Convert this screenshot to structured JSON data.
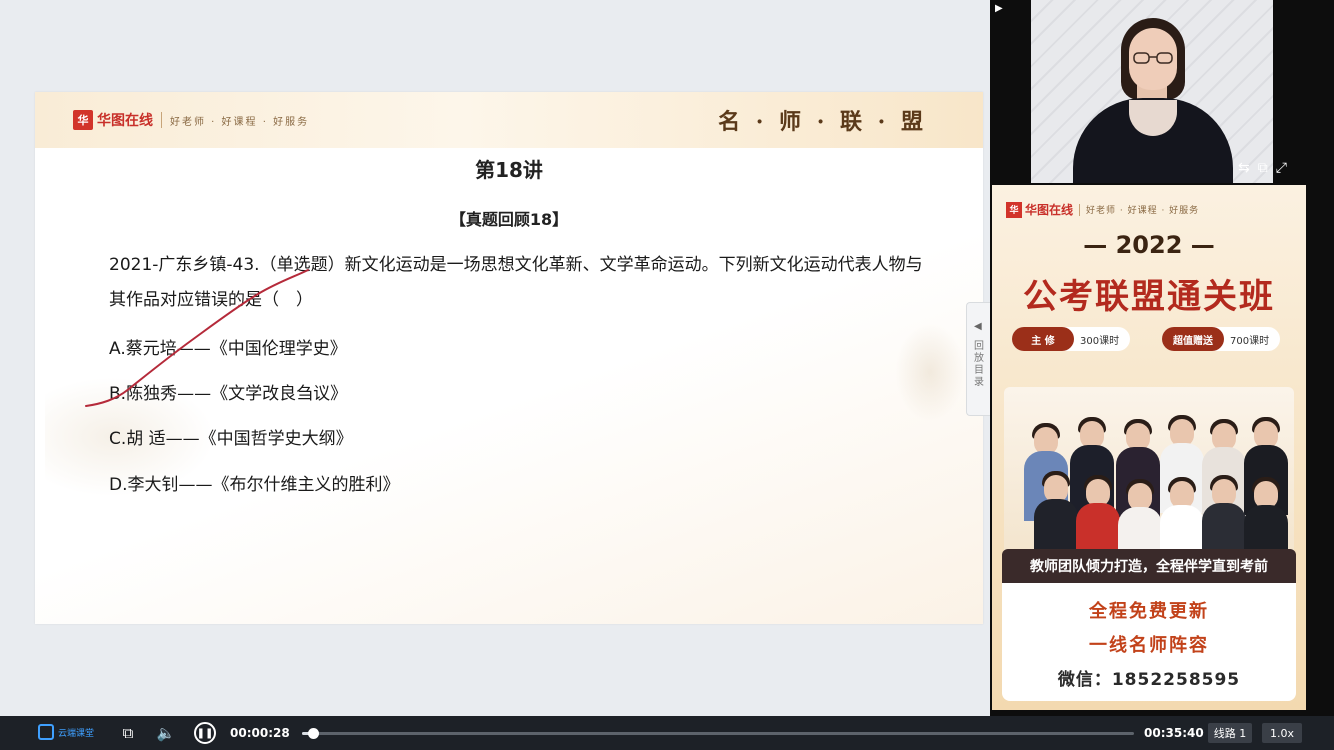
{
  "slide": {
    "brand_logo": "华",
    "brand_name": "华图在线",
    "brand_slogan": "好老师 · 好课程 · 好服务",
    "header_right": "名 · 师 · 联 · 盟",
    "lecture_title": "第18讲",
    "review_title": "【真题回顾18】",
    "question": "2021-广东乡镇-43.（单选题）新文化运动是一场思想文化革新、文学革命运动。下列新文化运动代表人物与其作品对应错误的是（　）",
    "options": [
      "A.蔡元培——《中国伦理学史》",
      "B.陈独秀——《文学改良刍议》",
      "C.胡 适——《中国哲学史大纲》",
      "D.李大钊——《布尔什维主义的胜利》"
    ],
    "pen_color": "#b52a3a"
  },
  "sidebar": {
    "collapse_arrow": "◀",
    "collapse_label": "回放目录"
  },
  "camera": {
    "top_arrow": "▶",
    "controls": [
      "⇆",
      "⧉",
      "⤢"
    ]
  },
  "ad": {
    "brand_logo": "华",
    "brand_name": "华图在线",
    "brand_slogan": "好老师 · 好课程 · 好服务",
    "year": "— 2022 —",
    "title": "公考联盟通关班",
    "pills": [
      {
        "tag": "主 修",
        "value": "300课时"
      },
      {
        "tag": "超值赠送",
        "value": "700课时"
      }
    ],
    "caption": "教师团队倾力打造，全程伴学直到考前",
    "line1": "全程免费更新",
    "line2": "一线名师阵容",
    "line3": "微信：18522585­95"
  },
  "player": {
    "logo_text": "云端课堂",
    "current_time": "00:00:28",
    "duration": "00:35:40",
    "progress_fraction": 0.013,
    "route_label": "线路 1",
    "speed_label": "1.0x",
    "icons": {
      "ppt": "⧉",
      "volume": "🔈",
      "pause": "❚❚"
    }
  }
}
